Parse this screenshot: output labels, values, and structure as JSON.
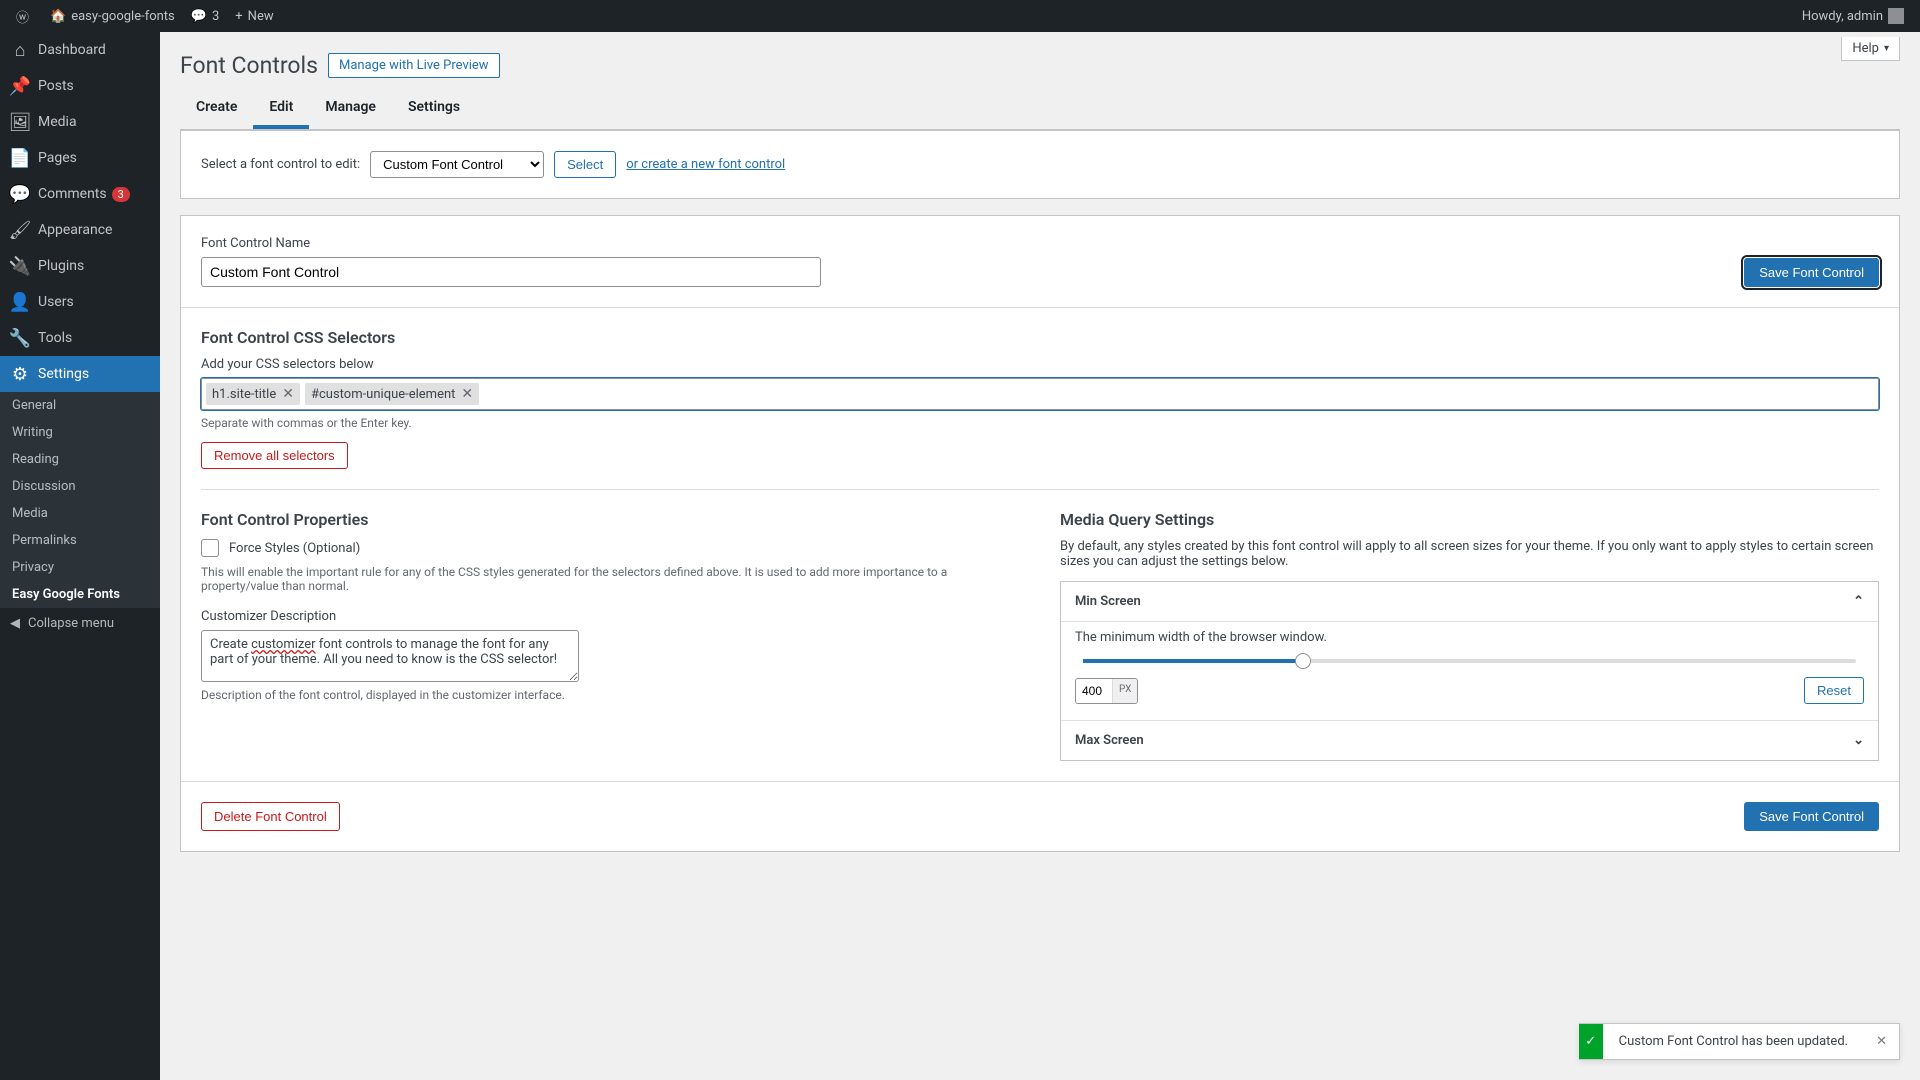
{
  "topbar": {
    "site_name": "easy-google-fonts",
    "comments": "3",
    "new": "New",
    "howdy": "Howdy, admin"
  },
  "sidebar": {
    "items": [
      {
        "label": "Dashboard",
        "icon": "dashboard",
        "active": false
      },
      {
        "label": "Posts",
        "icon": "posts",
        "active": false
      },
      {
        "label": "Media",
        "icon": "media",
        "active": false
      },
      {
        "label": "Pages",
        "icon": "pages",
        "active": false
      },
      {
        "label": "Comments",
        "icon": "comments",
        "active": false,
        "badge": "3"
      },
      {
        "label": "Appearance",
        "icon": "appearance",
        "active": false
      },
      {
        "label": "Plugins",
        "icon": "plugins",
        "active": false
      },
      {
        "label": "Users",
        "icon": "users",
        "active": false
      },
      {
        "label": "Tools",
        "icon": "tools",
        "active": false
      },
      {
        "label": "Settings",
        "icon": "settings",
        "active": true
      }
    ],
    "submenu": [
      "General",
      "Writing",
      "Reading",
      "Discussion",
      "Media",
      "Permalinks",
      "Privacy",
      "Easy Google Fonts"
    ],
    "submenu_active": 7,
    "collapse": "Collapse menu"
  },
  "page": {
    "title": "Font Controls",
    "live_preview": "Manage with Live Preview",
    "help": "Help",
    "tabs": [
      "Create",
      "Edit",
      "Manage",
      "Settings"
    ],
    "tab_active": 1,
    "select_label": "Select a font control to edit:",
    "select_value": "Custom Font Control",
    "select_btn": "Select",
    "select_link": "or create a new font control",
    "name_label": "Font Control Name",
    "name_value": "Custom Font Control",
    "save": "Save Font Control",
    "css_title": "Font Control CSS Selectors",
    "css_sub": "Add your CSS selectors below",
    "css_tags": [
      "h1.site-title",
      "#custom-unique-element"
    ],
    "css_hint": "Separate with commas or the Enter key.",
    "remove_all": "Remove all selectors",
    "props_title": "Font Control Properties",
    "force_label": "Force Styles (Optional)",
    "force_desc": "This will enable the important rule for any of the CSS styles generated for the selectors defined above. It is used to add more importance to a property/value than normal.",
    "cust_desc_label": "Customizer Description",
    "cust_desc_prefix": "Create ",
    "cust_desc_err": "customizer",
    "cust_desc_rest": " font controls to manage the font for any part of your theme. All you need to know is the CSS selector!",
    "cust_desc_hint": "Description of the font control, displayed in the customizer interface.",
    "media_title": "Media Query Settings",
    "media_desc": "By default, any styles created by this font control will apply to all screen sizes for your theme. If you only want to apply styles to certain screen sizes you can adjust the settings below.",
    "min_title": "Min Screen",
    "min_desc": "The minimum width of the browser window.",
    "min_value": "400",
    "min_unit": "PX",
    "reset": "Reset",
    "max_title": "Max Screen",
    "delete": "Delete Font Control"
  },
  "toast": {
    "text": "Custom Font Control has been updated."
  }
}
